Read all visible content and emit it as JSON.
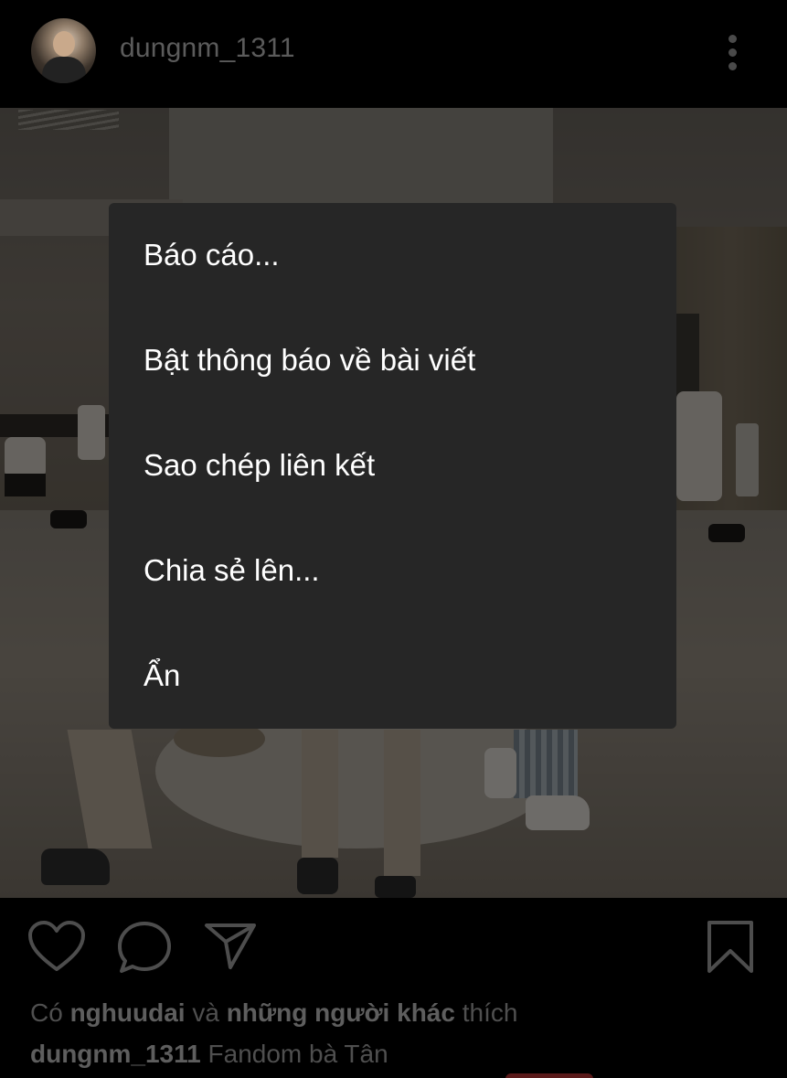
{
  "post": {
    "username": "dungnm_1311"
  },
  "menu": {
    "items": [
      {
        "label": "Báo cáo..."
      },
      {
        "label": "Bật thông báo về bài viết"
      },
      {
        "label": "Sao chép liên kết"
      },
      {
        "label": "Chia sẻ lên..."
      },
      {
        "label": "Ẩn"
      }
    ]
  },
  "actions": {
    "icons": [
      "heart-icon",
      "comment-icon",
      "share-icon",
      "bookmark-icon"
    ]
  },
  "likes": {
    "prefix": "Có",
    "user": "nghuudai",
    "middle": "và",
    "others": "những người khác",
    "suffix": "thích"
  },
  "caption": {
    "user": "dungnm_1311",
    "text": "Fandom bà Tân"
  },
  "colors": {
    "menu_bg": "#262626",
    "text_dim": "#4f4f4f",
    "background": "#000000"
  }
}
